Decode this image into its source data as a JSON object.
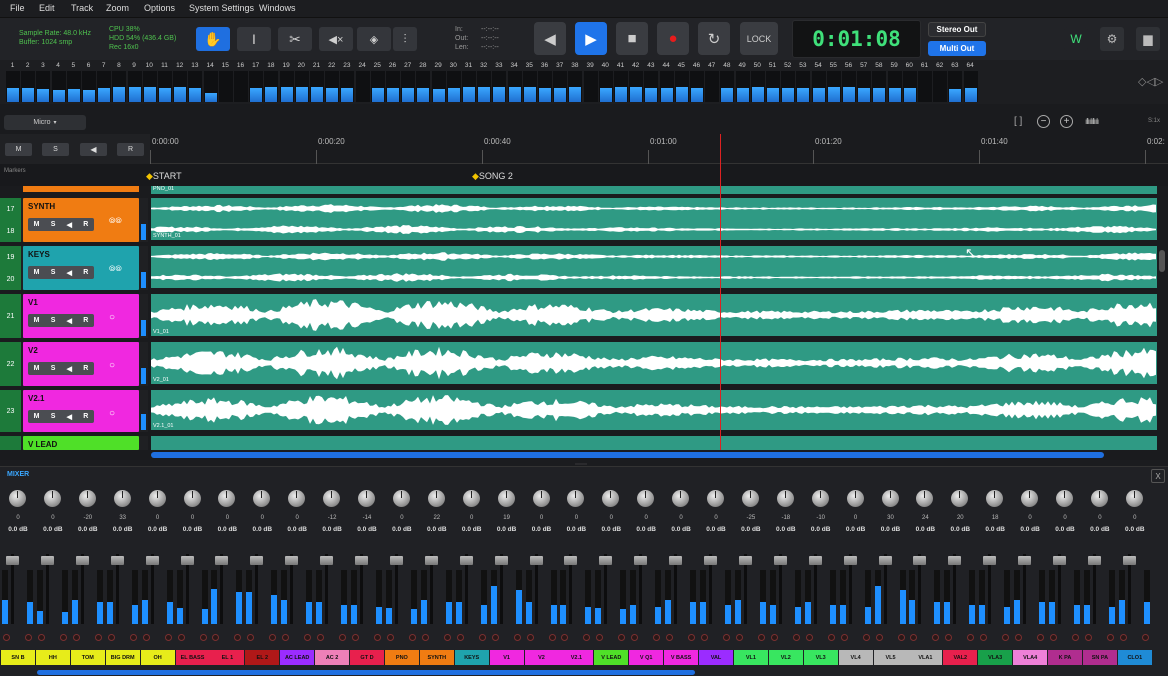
{
  "menu": [
    "File",
    "Edit",
    "Track",
    "Zoom",
    "Options",
    "System Settings",
    "Windows"
  ],
  "status": {
    "sample_rate": "Sample Rate: 48.0 kHz",
    "buffer": "Buffer: 1024 smp",
    "cpu": "CPU 38%",
    "hdd": "HDD 54% (436.4 GB)",
    "rec": "Rec 16x0"
  },
  "io": {
    "in": "In:",
    "out": "Out:",
    "len": "Len:",
    "in_v": "--:--:--",
    "out_v": "--:--:--",
    "len_v": "--:--:--"
  },
  "transport": {
    "lock": "LOCK",
    "time": "0:01:08"
  },
  "outputs": {
    "stereo": "Stereo Out",
    "multi": "Multi Out"
  },
  "meter_numbers": [
    "1",
    "2",
    "3",
    "4",
    "5",
    "6",
    "7",
    "8",
    "9",
    "10",
    "11",
    "12",
    "13",
    "14",
    "15",
    "16",
    "17",
    "18",
    "19",
    "20",
    "21",
    "22",
    "23",
    "24",
    "25",
    "26",
    "27",
    "28",
    "29",
    "30",
    "31",
    "32",
    "33",
    "34",
    "35",
    "36",
    "37",
    "38",
    "39",
    "40",
    "41",
    "42",
    "43",
    "44",
    "45",
    "46",
    "47",
    "48",
    "49",
    "50",
    "51",
    "52",
    "53",
    "54",
    "55",
    "56",
    "57",
    "58",
    "59",
    "60",
    "61",
    "62",
    "63",
    "64"
  ],
  "meter_levels": [
    0.45,
    0.45,
    0.42,
    0.4,
    0.42,
    0.4,
    0.45,
    0.48,
    0.5,
    0.48,
    0.45,
    0.5,
    0.45,
    0.3,
    0,
    0,
    0.45,
    0.5,
    0.48,
    0.5,
    0.48,
    0.45,
    0.45,
    0,
    0.45,
    0.45,
    0.45,
    0.45,
    0.42,
    0.45,
    0.48,
    0.48,
    0.5,
    0.48,
    0.48,
    0.45,
    0.45,
    0.48,
    0,
    0.45,
    0.5,
    0.48,
    0.45,
    0.45,
    0.48,
    0.45,
    0,
    0.45,
    0.45,
    0.48,
    0.45,
    0.45,
    0.45,
    0.45,
    0.5,
    0.48,
    0.45,
    0.45,
    0.45,
    0.45,
    0,
    0,
    0.42,
    0.45
  ],
  "midi": "Micro",
  "side_scale": "S:1x",
  "ruler": [
    "0:00:00",
    "0:00:20",
    "0:00:40",
    "0:01:00",
    "0:01:20",
    "0:01:40",
    "0:02:"
  ],
  "markers": {
    "label": "Markers",
    "start": "START",
    "song2": "SONG 2"
  },
  "global_msr": [
    "M",
    "S",
    "R"
  ],
  "tracks": [
    {
      "nums": [
        "17",
        "18"
      ],
      "name": "SYNTH",
      "color": "#f07c12",
      "clip": "SYNTH_01",
      "top_clip": "PNO_01"
    },
    {
      "nums": [
        "19",
        "20"
      ],
      "name": "KEYS",
      "color": "#1fa3ad",
      "clip": ""
    },
    {
      "nums": [
        "21"
      ],
      "name": "V1",
      "color": "#f028e0",
      "clip": "V1_01"
    },
    {
      "nums": [
        "22"
      ],
      "name": "V2",
      "color": "#f028e0",
      "clip": "V2_01"
    },
    {
      "nums": [
        "23"
      ],
      "name": "V2.1",
      "color": "#f028e0",
      "clip": "V2.1_01"
    },
    {
      "nums": [
        ""
      ],
      "name": "V LEAD",
      "color": "#4fe028",
      "clip": ""
    }
  ],
  "mixer": {
    "title": "MIXER",
    "close": "X",
    "channels": [
      {
        "pan": "0",
        "vol": "0.0 dB",
        "label": "SN B",
        "color": "#e7ec1a",
        "l": 0.45
      },
      {
        "pan": "0",
        "vol": "0.0 dB",
        "label": "HH",
        "color": "#e7ec1a",
        "l": 0.25
      },
      {
        "pan": "-20",
        "vol": "0.0 dB",
        "label": "TOM",
        "color": "#e7ec1a",
        "l": 0.45
      },
      {
        "pan": "33",
        "vol": "0.0 dB",
        "label": "BIG DRM",
        "color": "#e7ec1a",
        "l": 0.4
      },
      {
        "pan": "0",
        "vol": "0.0 dB",
        "label": "OH",
        "color": "#e7ec1a",
        "l": 0.45
      },
      {
        "pan": "0",
        "vol": "0.0 dB",
        "label": "EL BASS",
        "color": "#e8204d",
        "l": 0.3
      },
      {
        "pan": "0",
        "vol": "0.0 dB",
        "label": "EL 1",
        "color": "#e8204d",
        "l": 0.65
      },
      {
        "pan": "0",
        "vol": "0.0 dB",
        "label": "EL 2",
        "color": "#b01818",
        "l": 0.6
      },
      {
        "pan": "0",
        "vol": "0.0 dB",
        "label": "AC LEAD",
        "color": "#9b2cff",
        "l": 0.45
      },
      {
        "pan": "-12",
        "vol": "0.0 dB",
        "label": "AC 2",
        "color": "#ee80b8",
        "l": 0.4
      },
      {
        "pan": "-14",
        "vol": "0.0 dB",
        "label": "GT D",
        "color": "#e8204d",
        "l": 0.35
      },
      {
        "pan": "0",
        "vol": "0.0 dB",
        "label": "PNO",
        "color": "#f07c12",
        "l": 0.3
      },
      {
        "pan": "22",
        "vol": "0.0 dB",
        "label": "SYNTH",
        "color": "#f07c12",
        "l": 0.45
      },
      {
        "pan": "0",
        "vol": "0.0 dB",
        "label": "KEYS",
        "color": "#1fa3ad",
        "l": 0.4
      },
      {
        "pan": "19",
        "vol": "0.0 dB",
        "label": "V1",
        "color": "#f028e0",
        "l": 0.7
      },
      {
        "pan": "0",
        "vol": "0.0 dB",
        "label": "V2",
        "color": "#f028e0",
        "l": 0.4
      },
      {
        "pan": "0",
        "vol": "0.0 dB",
        "label": "V2.1",
        "color": "#f028e0",
        "l": 0.35
      },
      {
        "pan": "0",
        "vol": "0.0 dB",
        "label": "V LEAD",
        "color": "#4fe028",
        "l": 0.3
      },
      {
        "pan": "0",
        "vol": "0.0 dB",
        "label": "V Q1",
        "color": "#f028e0",
        "l": 0.35
      },
      {
        "pan": "0",
        "vol": "0.0 dB",
        "label": "V BASS",
        "color": "#f028e0",
        "l": 0.45
      },
      {
        "pan": "0",
        "vol": "0.0 dB",
        "label": "VAL",
        "color": "#9b2cff",
        "l": 0.4
      },
      {
        "pan": "-25",
        "vol": "0.0 dB",
        "label": "VL1",
        "color": "#38e660",
        "l": 0.45
      },
      {
        "pan": "-18",
        "vol": "0.0 dB",
        "label": "VL2",
        "color": "#38e660",
        "l": 0.35
      },
      {
        "pan": "-10",
        "vol": "0.0 dB",
        "label": "VL3",
        "color": "#38e660",
        "l": 0.4
      },
      {
        "pan": "0",
        "vol": "0.0 dB",
        "label": "VL4",
        "color": "#b8b8b8",
        "l": 0.35
      },
      {
        "pan": "30",
        "vol": "0.0 dB",
        "label": "VL5",
        "color": "#b8b8b8",
        "l": 0.7
      },
      {
        "pan": "24",
        "vol": "0.0 dB",
        "label": "VLA1",
        "color": "#b8b8b8",
        "l": 0.45
      },
      {
        "pan": "20",
        "vol": "0.0 dB",
        "label": "VAL2",
        "color": "#e8204d",
        "l": 0.4
      },
      {
        "pan": "18",
        "vol": "0.0 dB",
        "label": "VLA3",
        "color": "#18a04a",
        "l": 0.35
      },
      {
        "pan": "0",
        "vol": "0.0 dB",
        "label": "VLA4",
        "color": "#ee80d8",
        "l": 0.45
      },
      {
        "pan": "0",
        "vol": "0.0 dB",
        "label": "K PA",
        "color": "#b02d8f",
        "l": 0.4
      },
      {
        "pan": "0",
        "vol": "0.0 dB",
        "label": "SN PA",
        "color": "#b02d8f",
        "l": 0.35
      },
      {
        "pan": "0",
        "vol": "0.0 dB",
        "label": "CLO1",
        "color": "#1f8bd6",
        "l": 0.45
      }
    ]
  },
  "icons": {
    "hand": "hand-icon",
    "ibeam": "text-cursor-icon",
    "cut": "scissors-icon",
    "mute": "mute-icon",
    "snap": "snap-icon",
    "eq": "sliders-icon"
  }
}
